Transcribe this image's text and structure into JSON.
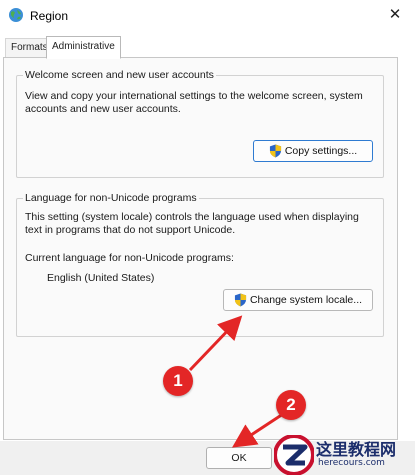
{
  "window": {
    "title": "Region",
    "close_glyph": "✕"
  },
  "tabs": [
    {
      "label": "Formats",
      "active": false
    },
    {
      "label": "Administrative",
      "active": true
    }
  ],
  "welcome": {
    "legend": "Welcome screen and new user accounts",
    "description": "View and copy your international settings to the welcome screen, system accounts and new user accounts.",
    "copy_button": "Copy settings..."
  },
  "non_unicode": {
    "legend": "Language for non-Unicode programs",
    "description": "This setting (system locale) controls the language used when displaying text in programs that do not support Unicode.",
    "current_label": "Current language for non-Unicode programs:",
    "current_value": "English (United States)",
    "change_button": "Change system locale..."
  },
  "footer": {
    "ok_button": "OK"
  },
  "annotations": [
    {
      "number": "1"
    },
    {
      "number": "2"
    }
  ],
  "watermark": {
    "text": "这里教程网",
    "url": "herecours.com"
  },
  "colors": {
    "annotation_red": "#e32626",
    "focus_blue": "#2f7bd1",
    "watermark_navy": "#1b2d6b"
  },
  "icons": [
    "globe-icon",
    "close-icon",
    "uac-shield-icon",
    "arrow-icon"
  ]
}
